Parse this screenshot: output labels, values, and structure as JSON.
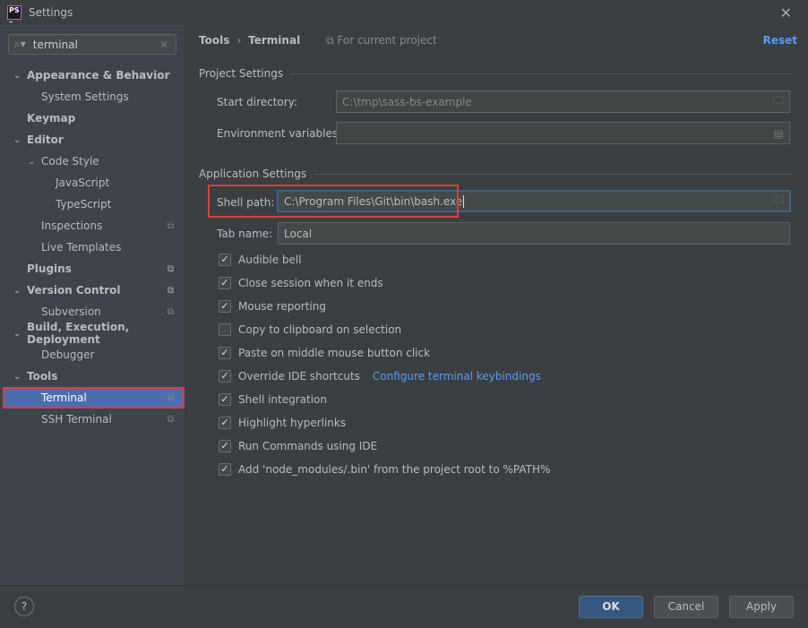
{
  "window": {
    "title": "Settings",
    "logo": "PS"
  },
  "search": {
    "value": "terminal"
  },
  "tree": [
    {
      "label": "Appearance & Behavior",
      "bold": true,
      "level": 0,
      "chevron": "down"
    },
    {
      "label": "System Settings",
      "level": 1
    },
    {
      "label": "Keymap",
      "bold": true,
      "level": 0
    },
    {
      "label": "Editor",
      "bold": true,
      "level": 0,
      "chevron": "down"
    },
    {
      "label": "Code Style",
      "level": 1,
      "chevron": "down"
    },
    {
      "label": "JavaScript",
      "level": 2
    },
    {
      "label": "TypeScript",
      "level": 2
    },
    {
      "label": "Inspections",
      "level": 1,
      "copy": true
    },
    {
      "label": "Live Templates",
      "level": 1
    },
    {
      "label": "Plugins",
      "bold": true,
      "level": 0,
      "copy": true
    },
    {
      "label": "Version Control",
      "bold": true,
      "level": 0,
      "chevron": "down",
      "copy": true
    },
    {
      "label": "Subversion",
      "level": 1,
      "copy": true
    },
    {
      "label": "Build, Execution, Deployment",
      "bold": true,
      "level": 0,
      "chevron": "down"
    },
    {
      "label": "Debugger",
      "level": 1
    },
    {
      "label": "Tools",
      "bold": true,
      "level": 0,
      "chevron": "down"
    },
    {
      "label": "Terminal",
      "level": 1,
      "copy": true,
      "selected": true
    },
    {
      "label": "SSH Terminal",
      "level": 1,
      "copy": true
    }
  ],
  "header": {
    "crumb1": "Tools",
    "crumb2": "Terminal",
    "scope": "For current project",
    "reset": "Reset"
  },
  "project": {
    "title": "Project Settings",
    "start_label": "Start directory:",
    "start_value": "C:\\tmp\\sass-bs-example",
    "env_label": "Environment variables:",
    "env_value": ""
  },
  "app": {
    "title": "Application Settings",
    "shell_label": "Shell path:",
    "shell_value": "C:\\Program Files\\Git\\bin\\bash.exe",
    "tab_label": "Tab name:",
    "tab_value": "Local"
  },
  "checkboxes": [
    {
      "label": "Audible bell",
      "checked": true
    },
    {
      "label": "Close session when it ends",
      "checked": true
    },
    {
      "label": "Mouse reporting",
      "checked": true
    },
    {
      "label": "Copy to clipboard on selection",
      "checked": false
    },
    {
      "label": "Paste on middle mouse button click",
      "checked": true
    },
    {
      "label": "Override IDE shortcuts",
      "checked": true,
      "link": "Configure terminal keybindings"
    },
    {
      "label": "Shell integration",
      "checked": true
    },
    {
      "label": "Highlight hyperlinks",
      "checked": true
    },
    {
      "label": "Run Commands using IDE",
      "checked": true
    },
    {
      "label": "Add 'node_modules/.bin' from the project root to %PATH%",
      "checked": true
    }
  ],
  "footer": {
    "help": "?",
    "ok": "OK",
    "cancel": "Cancel",
    "apply": "Apply"
  },
  "colors": {
    "accent": "#589df6",
    "highlight": "#e5393d",
    "selection": "#4b6eaf"
  }
}
